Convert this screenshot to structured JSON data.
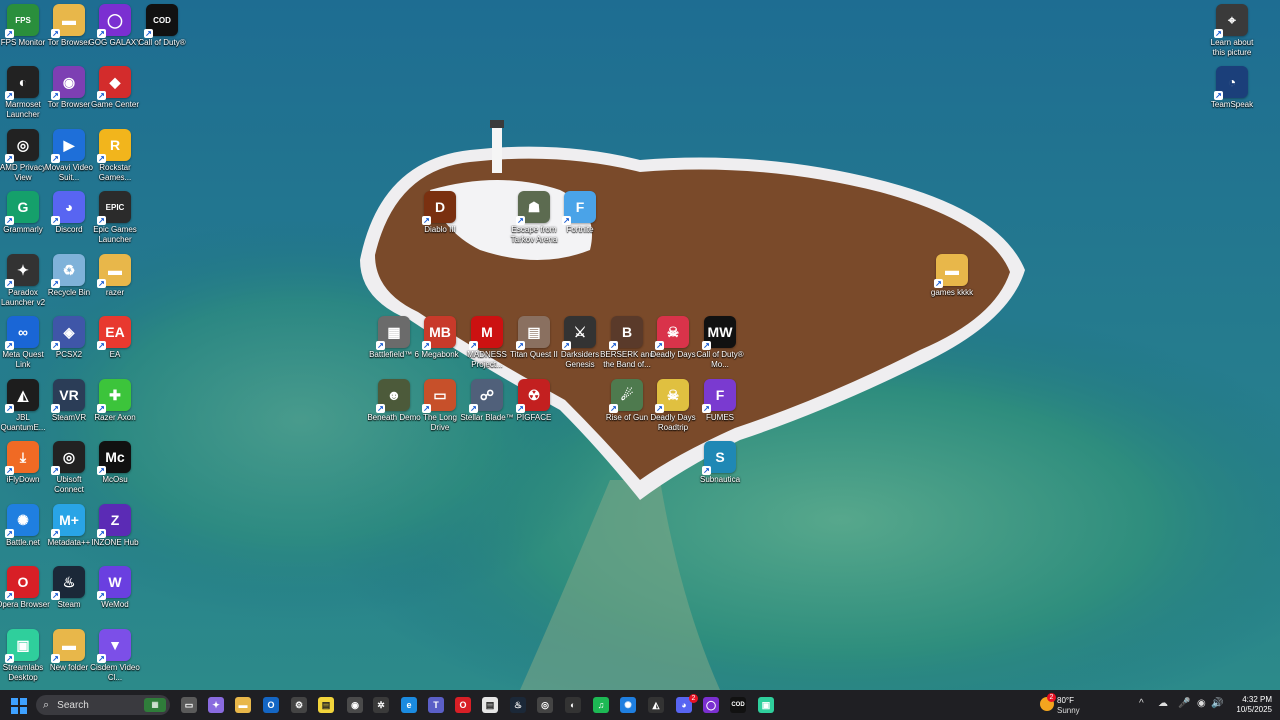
{
  "desktop": {
    "icons": [
      {
        "label": "FPS Monitor",
        "color": "#2a8f3c",
        "glyph": "FPS"
      },
      {
        "label": "Tor Browser",
        "color": "#e8b74a",
        "glyph": "▬"
      },
      {
        "label": "GOG GALAXY",
        "color": "#7b2fd1",
        "glyph": "◯"
      },
      {
        "label": "Call of Duty®",
        "color": "#111111",
        "glyph": "COD"
      },
      {
        "label": "Marmoset Launcher",
        "color": "#222222",
        "glyph": "◐"
      },
      {
        "label": "Tor Browser",
        "color": "#7d3fb3",
        "glyph": "◉"
      },
      {
        "label": "Game Center",
        "color": "#d32c2c",
        "glyph": "◆"
      },
      {
        "label": "AMD Privacy View",
        "color": "#222222",
        "glyph": "◎"
      },
      {
        "label": "Movavi Video Suit...",
        "color": "#1e6fd9",
        "glyph": "▶"
      },
      {
        "label": "Rockstar Games...",
        "color": "#f2b51c",
        "glyph": "R"
      },
      {
        "label": "Grammarly",
        "color": "#15a06b",
        "glyph": "G"
      },
      {
        "label": "Discord",
        "color": "#5865f2",
        "glyph": "◕"
      },
      {
        "label": "Epic Games Launcher",
        "color": "#2b2b2b",
        "glyph": "EPIC"
      },
      {
        "label": "Paradox Launcher v2",
        "color": "#333333",
        "glyph": "✦"
      },
      {
        "label": "Recycle Bin",
        "color": "#7fb2d9",
        "glyph": "♻"
      },
      {
        "label": "razer",
        "color": "#e8b74a",
        "glyph": "▬"
      },
      {
        "label": "Meta Quest Link",
        "color": "#1a66d6",
        "glyph": "∞"
      },
      {
        "label": "PCSX2",
        "color": "#3f56a8",
        "glyph": "◈"
      },
      {
        "label": "EA",
        "color": "#e8392f",
        "glyph": "EA"
      },
      {
        "label": "JBL QuantumE...",
        "color": "#1d1d1d",
        "glyph": "◭"
      },
      {
        "label": "SteamVR",
        "color": "#2b3d57",
        "glyph": "VR"
      },
      {
        "label": "Razer Axon",
        "color": "#3cc43b",
        "glyph": "✚"
      },
      {
        "label": "iFlyDown",
        "color": "#f06a24",
        "glyph": "⤓"
      },
      {
        "label": "Ubisoft Connect",
        "color": "#222222",
        "glyph": "◎"
      },
      {
        "label": "McOsu",
        "color": "#111111",
        "glyph": "Mc"
      },
      {
        "label": "Battle.net",
        "color": "#1f7fe0",
        "glyph": "✺"
      },
      {
        "label": "Metadata++",
        "color": "#29a4e6",
        "glyph": "M+"
      },
      {
        "label": "INZONE Hub",
        "color": "#5b2bb5",
        "glyph": "Z"
      },
      {
        "label": "Opera Browser",
        "color": "#d81f26",
        "glyph": "O"
      },
      {
        "label": "Steam",
        "color": "#1b2838",
        "glyph": "♨"
      },
      {
        "label": "WeMod",
        "color": "#6a3fe0",
        "glyph": "W"
      },
      {
        "label": "Streamlabs Desktop",
        "color": "#2fcf9c",
        "glyph": "▣"
      },
      {
        "label": "New folder",
        "color": "#e8b74a",
        "glyph": "▬"
      },
      {
        "label": "Cisdem Video Cl...",
        "color": "#7c4fe8",
        "glyph": "▼"
      },
      {
        "label": "Diablo III",
        "color": "#7a3010",
        "glyph": "D"
      },
      {
        "label": "Escape from Tarkov Arena",
        "color": "#5c6b50",
        "glyph": "☗"
      },
      {
        "label": "Fortnite",
        "color": "#4aa3e8",
        "glyph": "F"
      },
      {
        "label": "games kkkk",
        "color": "#e8b74a",
        "glyph": "▬"
      },
      {
        "label": "Battlefield™ 6",
        "color": "#6b6b6b",
        "glyph": "▦"
      },
      {
        "label": "Megabonk",
        "color": "#c83a2a",
        "glyph": "MB"
      },
      {
        "label": "MADNESS Project...",
        "color": "#cc1111",
        "glyph": "M"
      },
      {
        "label": "Titan Quest II",
        "color": "#8a7060",
        "glyph": "▤"
      },
      {
        "label": "Darksiders Genesis",
        "color": "#333333",
        "glyph": "⚔"
      },
      {
        "label": "BERSERK and the Band of...",
        "color": "#5a3a2a",
        "glyph": "B"
      },
      {
        "label": "Deadly Days",
        "color": "#d9334a",
        "glyph": "☠"
      },
      {
        "label": "Call of Duty® Mo...",
        "color": "#111111",
        "glyph": "MW"
      },
      {
        "label": "Beneath Demo",
        "color": "#4c5a3a",
        "glyph": "☻"
      },
      {
        "label": "The Long Drive",
        "color": "#c7502a",
        "glyph": "▭"
      },
      {
        "label": "Stellar Blade™",
        "color": "#50607a",
        "glyph": "☍"
      },
      {
        "label": "PIGFACE",
        "color": "#c32020",
        "glyph": "☢"
      },
      {
        "label": "Rise of Gun",
        "color": "#4e7a4e",
        "glyph": "☄"
      },
      {
        "label": "Deadly Days Roadtrip",
        "color": "#e0c040",
        "glyph": "☠"
      },
      {
        "label": "FUMES",
        "color": "#7a3ad0",
        "glyph": "F"
      },
      {
        "label": "Subnautica",
        "color": "#1f88b5",
        "glyph": "S"
      },
      {
        "label": "Learn about this picture",
        "color": "#3a3a3a",
        "glyph": "⌖"
      },
      {
        "label": "TeamSpeak",
        "color": "#1b3f7a",
        "glyph": "◔"
      }
    ]
  },
  "taskbar": {
    "search_label": "Search",
    "weather_temp": "80°F",
    "weather_cond": "Sunny",
    "weather_badge": "2",
    "discord_badge": "2",
    "time": "4:32 PM",
    "date": "10/5/2025",
    "apps": [
      {
        "name": "task-view-icon",
        "color": "#5a5a5a",
        "glyph": "▭"
      },
      {
        "name": "copilot-icon",
        "color": "#8a6bdf",
        "glyph": "✦"
      },
      {
        "name": "file-explorer-icon",
        "color": "#e8b74a",
        "glyph": "▬"
      },
      {
        "name": "outlook-icon",
        "color": "#1466c4",
        "glyph": "O"
      },
      {
        "name": "settings-icon",
        "color": "#444444",
        "glyph": "⚙"
      },
      {
        "name": "sticky-notes-icon",
        "color": "#f2d43b",
        "glyph": "▤"
      },
      {
        "name": "tor-browser-icon",
        "color": "#4a4a4a",
        "glyph": "◉"
      },
      {
        "name": "app-icon",
        "color": "#3a3a3a",
        "glyph": "✲"
      },
      {
        "name": "edge-icon",
        "color": "#1b8be0",
        "glyph": "e"
      },
      {
        "name": "teams-icon",
        "color": "#5b5fc7",
        "glyph": "T"
      },
      {
        "name": "opera-icon",
        "color": "#d81f26",
        "glyph": "O"
      },
      {
        "name": "notepad-icon",
        "color": "#e6e6e6",
        "glyph": "▤"
      },
      {
        "name": "steam-icon",
        "color": "#1b2838",
        "glyph": "♨"
      },
      {
        "name": "ubisoft-icon",
        "color": "#444444",
        "glyph": "◎"
      },
      {
        "name": "lens-icon",
        "color": "#333333",
        "glyph": "◐"
      },
      {
        "name": "spotify-icon",
        "color": "#1db954",
        "glyph": "♫"
      },
      {
        "name": "battle-net-icon",
        "color": "#1f7fe0",
        "glyph": "✺"
      },
      {
        "name": "jbl-icon",
        "color": "#333333",
        "glyph": "◭"
      },
      {
        "name": "discord-icon",
        "color": "#5865f2",
        "glyph": "◕"
      },
      {
        "name": "gog-icon",
        "color": "#7b2fd1",
        "glyph": "◯"
      },
      {
        "name": "cod-icon",
        "color": "#111111",
        "glyph": "COD"
      },
      {
        "name": "streamlabs-icon",
        "color": "#2fcf9c",
        "glyph": "▣"
      }
    ],
    "tray": [
      "^",
      "☁",
      "🎤",
      "◉",
      "🔊"
    ]
  }
}
